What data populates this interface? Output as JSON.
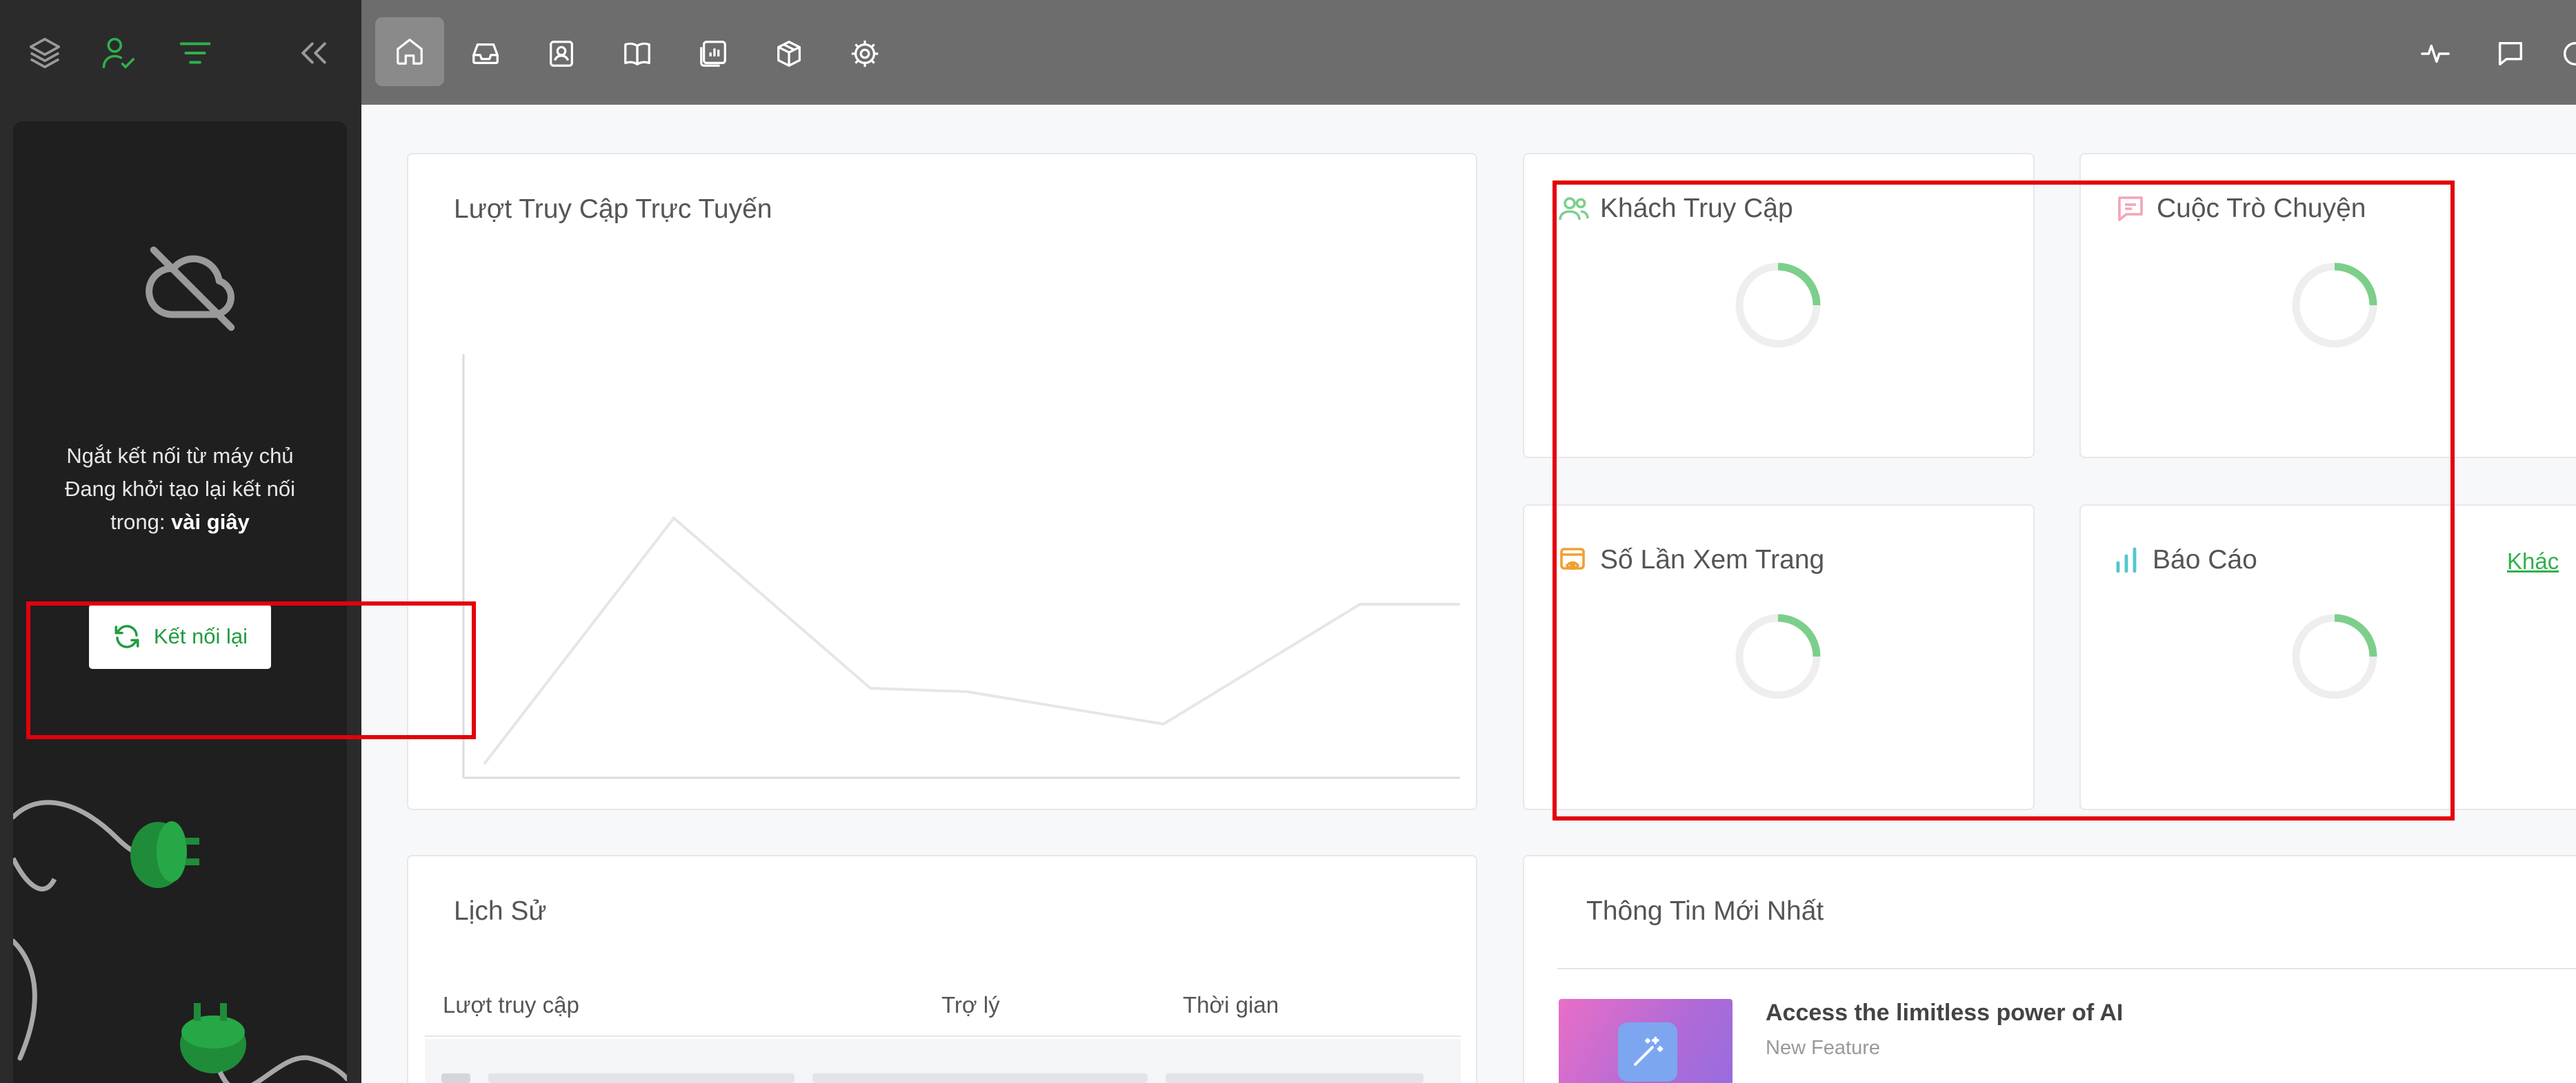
{
  "sidebar": {
    "disconnect_line1": "Ngắt kết nối từ máy chủ",
    "disconnect_line2": "Đang khởi tạo lại kết nối",
    "disconnect_line3_prefix": "trong: ",
    "disconnect_line3_bold": "vài giây",
    "reconnect_label": "Kết nối lại"
  },
  "topbar": {
    "nav_icons": [
      "home-icon",
      "inbox-icon",
      "contacts-icon",
      "book-icon",
      "reports-icon",
      "package-icon",
      "settings-icon"
    ],
    "right_icons": [
      "activity-icon",
      "chat-icon"
    ]
  },
  "online_visits": {
    "title": "Lượt Truy Cập Trực Tuyến"
  },
  "stats": {
    "visitors": {
      "title": "Khách Truy Cập"
    },
    "conversations": {
      "title": "Cuộc Trò Chuyện"
    },
    "pageviews": {
      "title": "Số Lần Xem Trang"
    },
    "reports": {
      "title": "Báo Cáo",
      "link": "Khác"
    }
  },
  "history": {
    "title": "Lịch Sử",
    "columns": [
      "Lượt truy cập",
      "Trợ lý",
      "Thời gian"
    ]
  },
  "news": {
    "title": "Thông Tin Mới Nhất",
    "item_title": "Access the limitless power of AI",
    "item_tag": "New Feature"
  },
  "colors": {
    "accent": "#2fb14c",
    "annotation": "#e3000b",
    "sidebar_bg": "#2b2b2b",
    "topbar_bg": "#6d6d6d"
  }
}
